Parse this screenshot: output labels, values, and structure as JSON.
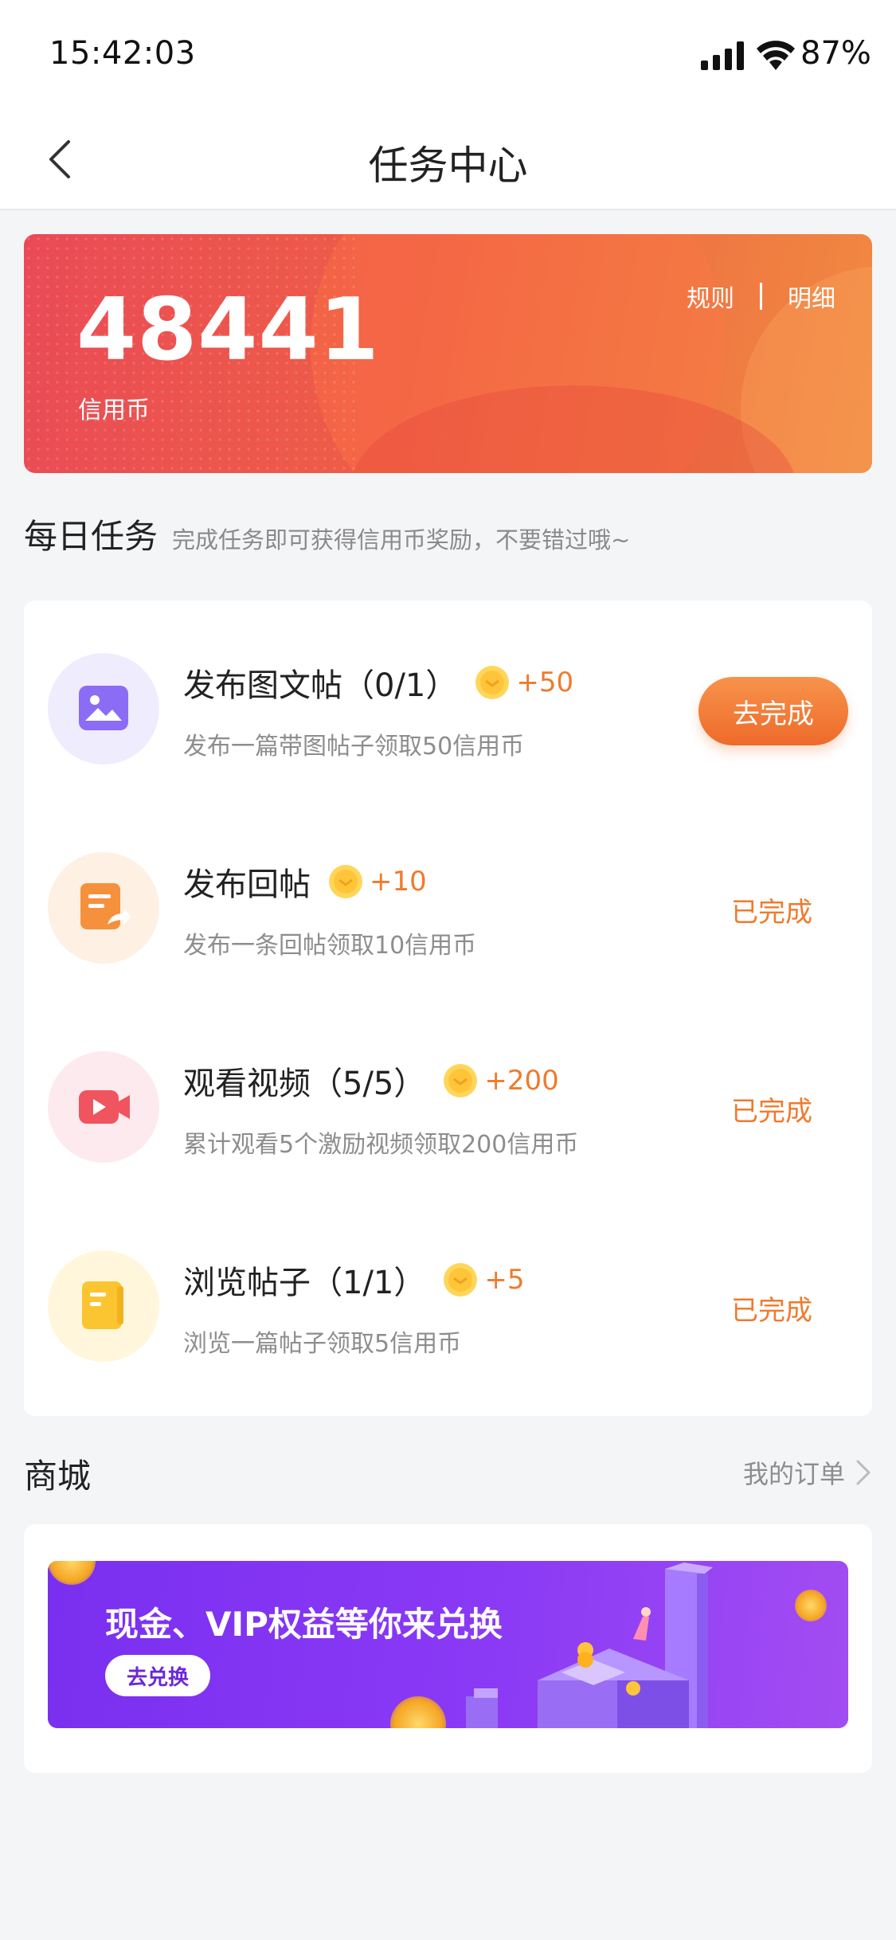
{
  "status_bar": {
    "time": "15:42:03",
    "battery": "87%"
  },
  "nav": {
    "title": "任务中心"
  },
  "banner": {
    "coins": "48441",
    "coins_label": "信用币",
    "rules": "规则",
    "details": "明细"
  },
  "daily": {
    "title": "每日任务",
    "subtitle": "完成任务即可获得信用币奖励，不要错过哦~",
    "tasks": [
      {
        "name": "发布图文帖（0/1）",
        "reward": "+50",
        "desc": "发布一篇带图帖子领取50信用币",
        "action": "去完成",
        "status": "pending",
        "icon": "image-icon"
      },
      {
        "name": "发布回帖",
        "reward": "+10",
        "desc": "发布一条回帖领取10信用币",
        "action": "已完成",
        "status": "done",
        "icon": "reply-icon"
      },
      {
        "name": "观看视频（5/5）",
        "reward": "+200",
        "desc": "累计观看5个激励视频领取200信用币",
        "action": "已完成",
        "status": "done",
        "icon": "video-icon"
      },
      {
        "name": "浏览帖子（1/1）",
        "reward": "+5",
        "desc": "浏览一篇帖子领取5信用币",
        "action": "已完成",
        "status": "done",
        "icon": "browse-icon"
      }
    ]
  },
  "shop": {
    "title": "商城",
    "orders_link": "我的订单",
    "promo": {
      "headline": "现金、VIP权益等你来兑换",
      "button": "去兑换"
    }
  },
  "colors": {
    "accent": "#f07a2d",
    "banner_start": "#ea4a57",
    "banner_end": "#f08a40",
    "promo": "#7a2ff0"
  }
}
